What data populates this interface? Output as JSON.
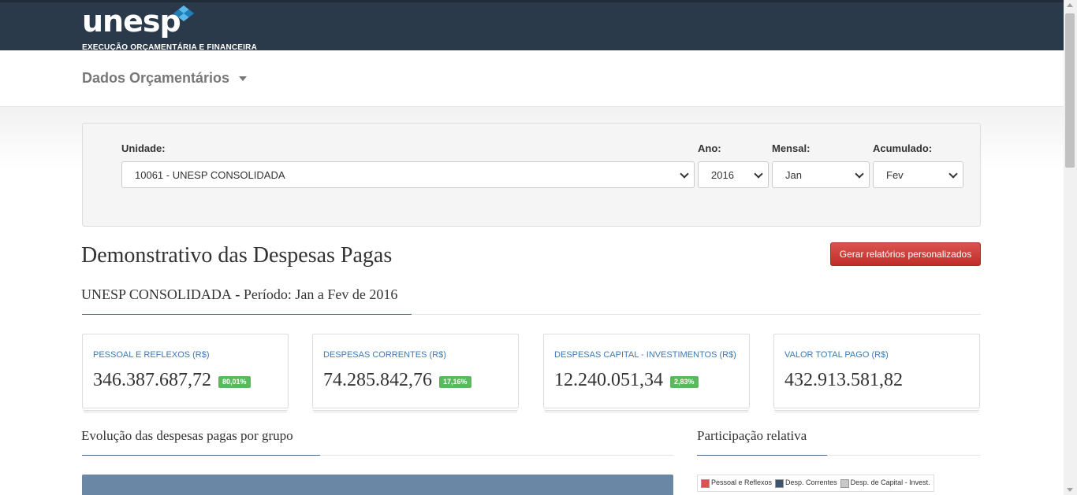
{
  "header": {
    "logo_text": "unesp",
    "logo_subtitle": "EXECUÇÃO ORÇAMENTÁRIA E FINANCEIRA",
    "logo_color": "#2e9fd8",
    "bg_color": "#2b3a4a"
  },
  "nav": {
    "menu_label": "Dados Orçamentários"
  },
  "filters": {
    "unidade_label": "Unidade:",
    "unidade_value": "10061 - UNESP CONSOLIDADA",
    "ano_label": "Ano:",
    "ano_value": "2016",
    "mensal_label": "Mensal:",
    "mensal_value": "Jan",
    "acumulado_label": "Acumulado:",
    "acumulado_value": "Fev"
  },
  "main": {
    "title": "Demonstrativo das Despesas Pagas",
    "report_button": "Gerar relatórios personalizados",
    "report_button_color": "#c9302c",
    "subtitle_unit": "UNESP CONSOLIDADA",
    "subtitle_sep": " - ",
    "subtitle_period": "Período: Jan a Fev de 2016"
  },
  "cards": [
    {
      "label": "PESSOAL E REFLEXOS (R$)",
      "value": "346.387.687,72",
      "badge": "80,01%"
    },
    {
      "label": "DESPESAS CORRENTES (R$)",
      "value": "74.285.842,76",
      "badge": "17,16%"
    },
    {
      "label": "DESPESAS CAPITAL - INVESTIMENTOS (R$)",
      "value": "12.240.051,34",
      "badge": "2,83%"
    },
    {
      "label": "VALOR TOTAL PAGO (R$)",
      "value": "432.913.581,82"
    }
  ],
  "sections": {
    "evolution_title": "Evolução das despesas pagas por grupo",
    "share_title": "Participação relativa"
  },
  "legend": [
    {
      "label": "Pessoal e Reflexos",
      "color": "#d9534f"
    },
    {
      "label": "Desp. Correntes",
      "color": "#3e546e"
    },
    {
      "label": "Desp. de Capital - Invest.",
      "color": "#c8c8c8"
    }
  ]
}
